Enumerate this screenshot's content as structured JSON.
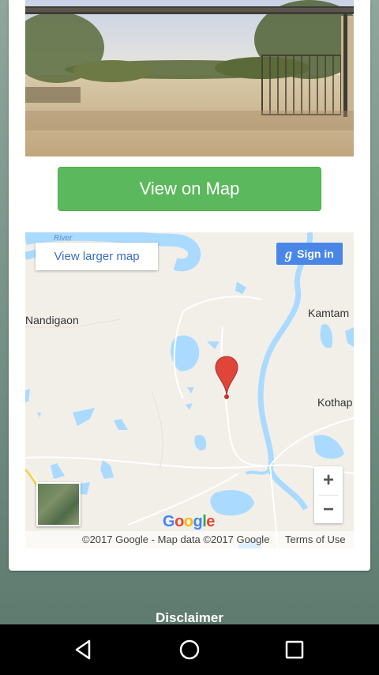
{
  "header_photo": {
    "alt": "",
    "banner_text": ""
  },
  "view_on_map": {
    "label": "View on Map"
  },
  "map": {
    "larger_map_label": "View larger map",
    "sign_in_label": "Sign in",
    "sign_in_glyph": "g",
    "places": {
      "left": "Nandigaon",
      "right_top": "Kamtam",
      "right_mid": "Kothap",
      "river": "River"
    },
    "zoom_in": "+",
    "zoom_out": "−",
    "logo": "Google",
    "attribution": "©2017 Google - Map data ©2017 Google",
    "terms": "Terms of Use",
    "colors": {
      "water": "#aadaff",
      "land": "#f2efe9",
      "road": "#ffffff",
      "pin": "#e0453a"
    }
  },
  "footer": {
    "disclaimer": "Disclaimer"
  },
  "navbar": {
    "back_icon": "back-triangle-icon",
    "home_icon": "home-circle-icon",
    "recents_icon": "recents-square-icon"
  }
}
